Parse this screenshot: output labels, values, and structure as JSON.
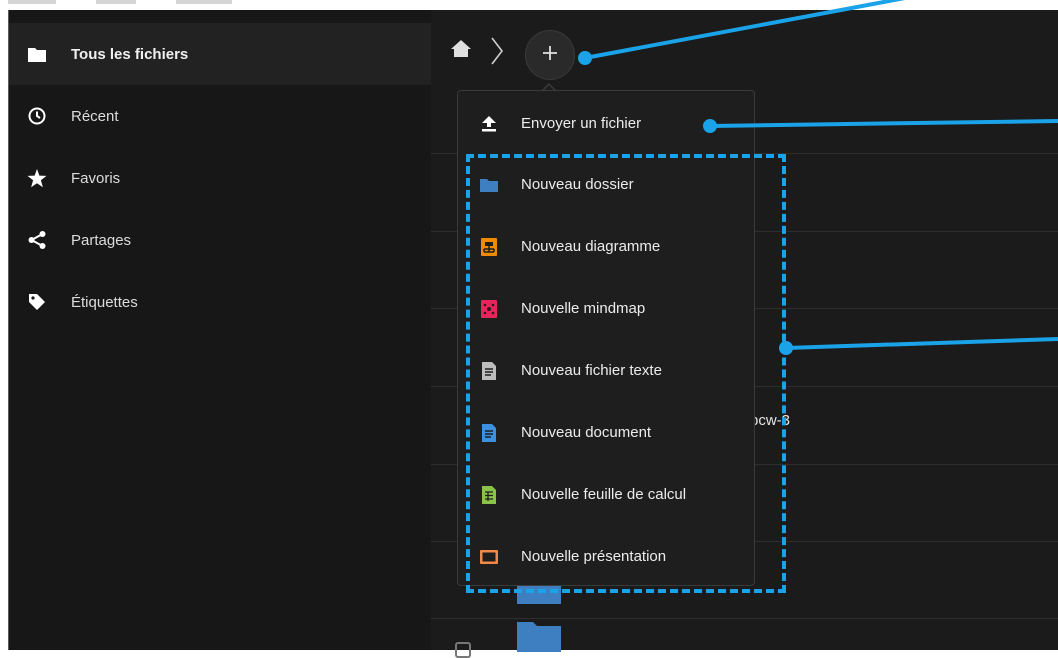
{
  "sidebar": {
    "items": [
      {
        "label": "Tous les fichiers",
        "icon": "folder-icon",
        "active": true
      },
      {
        "label": "Récent",
        "icon": "clock-icon",
        "active": false
      },
      {
        "label": "Favoris",
        "icon": "star-icon",
        "active": false
      },
      {
        "label": "Partages",
        "icon": "share-icon",
        "active": false
      },
      {
        "label": "Étiquettes",
        "icon": "tag-icon",
        "active": false
      }
    ]
  },
  "breadcrumb": {
    "home_icon": "home-icon",
    "separator_icon": "chevron-right-icon",
    "new_button_icon": "plus-icon"
  },
  "file_list": {
    "partial_name": "bcw-3"
  },
  "menu": {
    "items": [
      {
        "label": "Envoyer un fichier",
        "icon": "upload-icon",
        "color": "#ffffff"
      },
      {
        "label": "Nouveau dossier",
        "icon": "folder-icon",
        "color": "#3d7fc1"
      },
      {
        "label": "Nouveau diagramme",
        "icon": "diagram-icon",
        "color": "#f08a00"
      },
      {
        "label": "Nouvelle mindmap",
        "icon": "mindmap-icon",
        "color": "#e5265b"
      },
      {
        "label": "Nouveau fichier texte",
        "icon": "text-file-icon",
        "color": "#bdbdbd"
      },
      {
        "label": "Nouveau document",
        "icon": "document-icon",
        "color": "#3d8fe0"
      },
      {
        "label": "Nouvelle feuille de calcul",
        "icon": "spreadsheet-icon",
        "color": "#8bc34a"
      },
      {
        "label": "Nouvelle présentation",
        "icon": "presentation-icon",
        "color": "#f0884a"
      }
    ]
  },
  "colors": {
    "annotation": "#1aa3e8",
    "sidebar_bg": "#171717",
    "main_bg": "#1b1b1b"
  }
}
